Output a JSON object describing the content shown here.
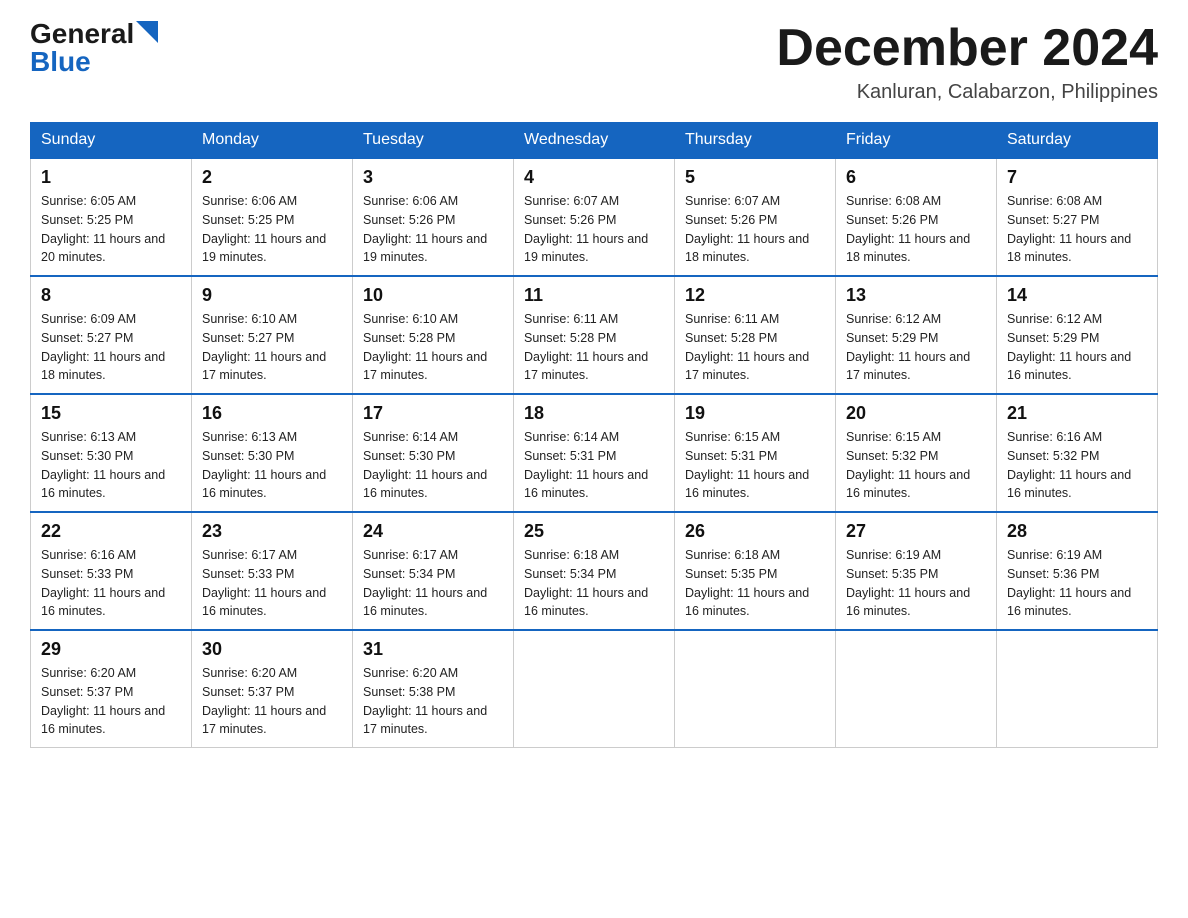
{
  "logo": {
    "general": "General",
    "blue": "Blue"
  },
  "title": "December 2024",
  "location": "Kanluran, Calabarzon, Philippines",
  "days_of_week": [
    "Sunday",
    "Monday",
    "Tuesday",
    "Wednesday",
    "Thursday",
    "Friday",
    "Saturday"
  ],
  "weeks": [
    [
      {
        "day": "1",
        "sunrise": "6:05 AM",
        "sunset": "5:25 PM",
        "daylight": "11 hours and 20 minutes."
      },
      {
        "day": "2",
        "sunrise": "6:06 AM",
        "sunset": "5:25 PM",
        "daylight": "11 hours and 19 minutes."
      },
      {
        "day": "3",
        "sunrise": "6:06 AM",
        "sunset": "5:26 PM",
        "daylight": "11 hours and 19 minutes."
      },
      {
        "day": "4",
        "sunrise": "6:07 AM",
        "sunset": "5:26 PM",
        "daylight": "11 hours and 19 minutes."
      },
      {
        "day": "5",
        "sunrise": "6:07 AM",
        "sunset": "5:26 PM",
        "daylight": "11 hours and 18 minutes."
      },
      {
        "day": "6",
        "sunrise": "6:08 AM",
        "sunset": "5:26 PM",
        "daylight": "11 hours and 18 minutes."
      },
      {
        "day": "7",
        "sunrise": "6:08 AM",
        "sunset": "5:27 PM",
        "daylight": "11 hours and 18 minutes."
      }
    ],
    [
      {
        "day": "8",
        "sunrise": "6:09 AM",
        "sunset": "5:27 PM",
        "daylight": "11 hours and 18 minutes."
      },
      {
        "day": "9",
        "sunrise": "6:10 AM",
        "sunset": "5:27 PM",
        "daylight": "11 hours and 17 minutes."
      },
      {
        "day": "10",
        "sunrise": "6:10 AM",
        "sunset": "5:28 PM",
        "daylight": "11 hours and 17 minutes."
      },
      {
        "day": "11",
        "sunrise": "6:11 AM",
        "sunset": "5:28 PM",
        "daylight": "11 hours and 17 minutes."
      },
      {
        "day": "12",
        "sunrise": "6:11 AM",
        "sunset": "5:28 PM",
        "daylight": "11 hours and 17 minutes."
      },
      {
        "day": "13",
        "sunrise": "6:12 AM",
        "sunset": "5:29 PM",
        "daylight": "11 hours and 17 minutes."
      },
      {
        "day": "14",
        "sunrise": "6:12 AM",
        "sunset": "5:29 PM",
        "daylight": "11 hours and 16 minutes."
      }
    ],
    [
      {
        "day": "15",
        "sunrise": "6:13 AM",
        "sunset": "5:30 PM",
        "daylight": "11 hours and 16 minutes."
      },
      {
        "day": "16",
        "sunrise": "6:13 AM",
        "sunset": "5:30 PM",
        "daylight": "11 hours and 16 minutes."
      },
      {
        "day": "17",
        "sunrise": "6:14 AM",
        "sunset": "5:30 PM",
        "daylight": "11 hours and 16 minutes."
      },
      {
        "day": "18",
        "sunrise": "6:14 AM",
        "sunset": "5:31 PM",
        "daylight": "11 hours and 16 minutes."
      },
      {
        "day": "19",
        "sunrise": "6:15 AM",
        "sunset": "5:31 PM",
        "daylight": "11 hours and 16 minutes."
      },
      {
        "day": "20",
        "sunrise": "6:15 AM",
        "sunset": "5:32 PM",
        "daylight": "11 hours and 16 minutes."
      },
      {
        "day": "21",
        "sunrise": "6:16 AM",
        "sunset": "5:32 PM",
        "daylight": "11 hours and 16 minutes."
      }
    ],
    [
      {
        "day": "22",
        "sunrise": "6:16 AM",
        "sunset": "5:33 PM",
        "daylight": "11 hours and 16 minutes."
      },
      {
        "day": "23",
        "sunrise": "6:17 AM",
        "sunset": "5:33 PM",
        "daylight": "11 hours and 16 minutes."
      },
      {
        "day": "24",
        "sunrise": "6:17 AM",
        "sunset": "5:34 PM",
        "daylight": "11 hours and 16 minutes."
      },
      {
        "day": "25",
        "sunrise": "6:18 AM",
        "sunset": "5:34 PM",
        "daylight": "11 hours and 16 minutes."
      },
      {
        "day": "26",
        "sunrise": "6:18 AM",
        "sunset": "5:35 PM",
        "daylight": "11 hours and 16 minutes."
      },
      {
        "day": "27",
        "sunrise": "6:19 AM",
        "sunset": "5:35 PM",
        "daylight": "11 hours and 16 minutes."
      },
      {
        "day": "28",
        "sunrise": "6:19 AM",
        "sunset": "5:36 PM",
        "daylight": "11 hours and 16 minutes."
      }
    ],
    [
      {
        "day": "29",
        "sunrise": "6:20 AM",
        "sunset": "5:37 PM",
        "daylight": "11 hours and 16 minutes."
      },
      {
        "day": "30",
        "sunrise": "6:20 AM",
        "sunset": "5:37 PM",
        "daylight": "11 hours and 17 minutes."
      },
      {
        "day": "31",
        "sunrise": "6:20 AM",
        "sunset": "5:38 PM",
        "daylight": "11 hours and 17 minutes."
      },
      null,
      null,
      null,
      null
    ]
  ]
}
